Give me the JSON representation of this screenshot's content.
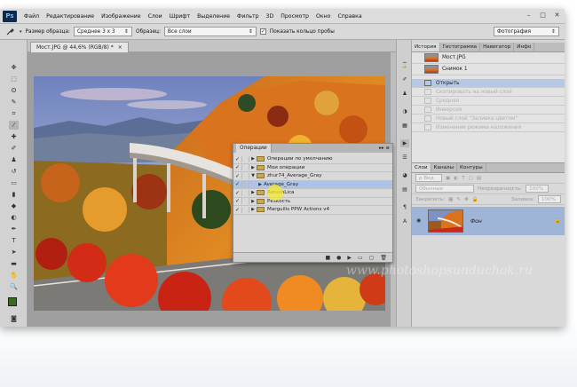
{
  "app": {
    "logo": "Ps"
  },
  "menu": [
    "Файл",
    "Редактирование",
    "Изображение",
    "Слои",
    "Шрифт",
    "Выделение",
    "Фильтр",
    "3D",
    "Просмотр",
    "Окно",
    "Справка"
  ],
  "window_controls": {
    "minimize": "–",
    "maximize": "□",
    "close": "✕"
  },
  "options_bar": {
    "sample_size_label": "Размер образца:",
    "sample_size_value": "Среднее 3 х 3",
    "sample_label": "Образец:",
    "sample_value": "Все слои",
    "show_ring_label": "Показать кольцо пробы",
    "show_ring_checked": "✓",
    "workspace_value": "Фотография"
  },
  "document": {
    "tab_title": "Мост.JPG @ 44,6% (RGB/8) *",
    "tab_close": "×"
  },
  "actions_panel": {
    "tab_label": "Операции",
    "header_controls": "▸▸ ≡",
    "rows": [
      {
        "label": "Операции по умолчанию",
        "type": "set",
        "expanded": "▶",
        "check": "✓"
      },
      {
        "label": "Мои операции",
        "type": "set",
        "expanded": "▶",
        "check": "✓"
      },
      {
        "label": "zhur74_Average_Gray",
        "type": "set",
        "expanded": "▼",
        "check": "✓"
      },
      {
        "label": "Average_Gray",
        "type": "action",
        "expanded": "▶",
        "check": "✓"
      },
      {
        "label": "RetushLica",
        "type": "set",
        "expanded": "▶",
        "check": "✓"
      },
      {
        "label": "Резкость",
        "type": "set",
        "expanded": "▶",
        "check": "✓"
      },
      {
        "label": "Marguilis PPW Actions v4",
        "type": "set",
        "expanded": "▶",
        "check": "✓"
      }
    ],
    "footer_icons": [
      "■",
      "●",
      "▶",
      "▭",
      "▢",
      "🗑"
    ]
  },
  "history_panel": {
    "tabs": [
      "История",
      "Гистограмма",
      "Навигатор",
      "Инфо"
    ],
    "snapshots": [
      "Мост.JPG",
      "Снимок 1"
    ],
    "states": [
      {
        "label": "Открыть",
        "current": true
      },
      {
        "label": "Скопировать на новый слой",
        "current": false
      },
      {
        "label": "Средняя",
        "current": false
      },
      {
        "label": "Инверсия",
        "current": false
      },
      {
        "label": "Новый слой \"Заливка цветом\"",
        "current": false
      },
      {
        "label": "Изменение режима наложения",
        "current": false
      }
    ]
  },
  "layers_panel": {
    "tabs": [
      "Слои",
      "Каналы",
      "Контуры"
    ],
    "kind_label": "Вид",
    "blend_mode": "Обычные",
    "opacity_label": "Непрозрачность:",
    "opacity_value": "100%",
    "lock_label": "Закрепить:",
    "fill_label": "Заливка:",
    "fill_value": "100%",
    "layer_name": "Фон"
  },
  "watermark": "www.photoshopsunduchok.ru",
  "colors": {
    "selection": "#aec4e6",
    "highlight": "#f6e82a"
  }
}
